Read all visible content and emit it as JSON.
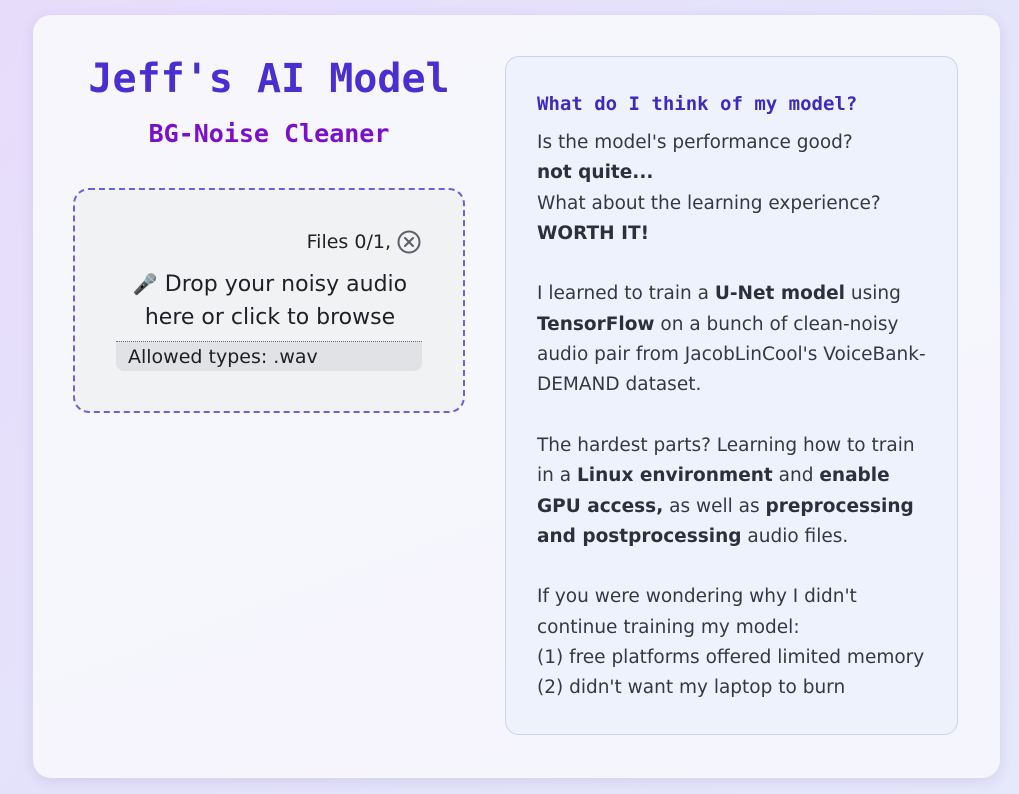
{
  "app": {
    "title": "Jeff's AI Model",
    "subtitle": "BG-Noise Cleaner"
  },
  "upload": {
    "files_count": "Files 0/1,",
    "clear_icon": "circle-x-icon",
    "mic_icon": "microphone-icon",
    "mic_glyph": "🎤",
    "drop_text": "Drop your noisy audio here or click to browse",
    "allowed_types": "Allowed types: .wav"
  },
  "panel": {
    "title": "What do I think of my model?",
    "q1": "Is the model's performance good?",
    "a1": "not quite...",
    "q2": "What about the learning experience?",
    "a2": "WORTH IT!",
    "p1_a": "I learned to train a ",
    "p1_b": "U-Net model",
    "p1_c": " using ",
    "p1_d": "TensorFlow",
    "p1_e": " on a bunch of clean-noisy audio pair from JacobLinCool's VoiceBank-DEMAND dataset.",
    "p2_a": "The hardest parts? Learning how to train in a ",
    "p2_b": "Linux environment",
    "p2_c": " and ",
    "p2_d": "enable GPU access,",
    "p2_e": " as well as ",
    "p2_f": "preprocessing and postprocessing",
    "p2_g": " audio files.",
    "p3_line1": "If you were wondering why I didn't continue training my model:",
    "p3_line2": "(1) free platforms offered limited memory",
    "p3_line3": "(2) didn't want my laptop to burn"
  },
  "colors": {
    "title": "#4a2ed0",
    "subtitle": "#7a10c8",
    "dropzone_border": "#6a63d8",
    "panel_title": "#3e2bbd"
  }
}
